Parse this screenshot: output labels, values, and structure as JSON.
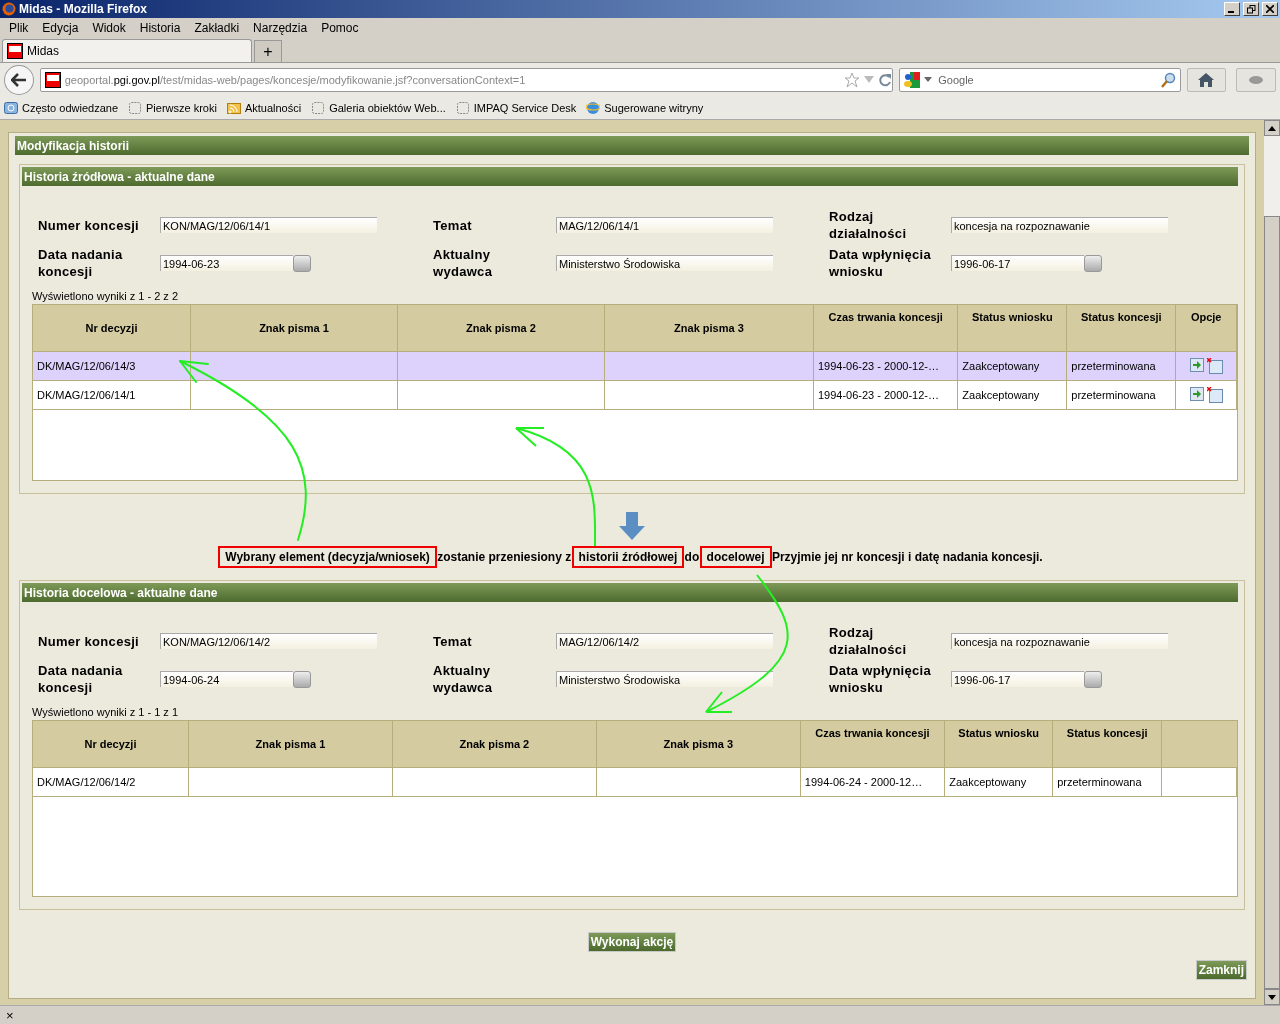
{
  "window": {
    "title": "Midas - Mozilla Firefox"
  },
  "menu": [
    "Plik",
    "Edycja",
    "Widok",
    "Historia",
    "Zakładki",
    "Narzędzia",
    "Pomoc"
  ],
  "tabs": [
    {
      "label": "Midas",
      "selected": true
    }
  ],
  "new_tab": "+",
  "address": {
    "host_pre": "geoportal.",
    "host": "pgi.gov.pl",
    "path": "/test/midas-web/pages/koncesje/modyfikowanie.jsf?conversationContext=1"
  },
  "search": {
    "placeholder": "Google"
  },
  "bookmarks": [
    {
      "label": "Często odwiedzane",
      "kind": "search"
    },
    {
      "label": "Pierwsze kroki",
      "kind": "page"
    },
    {
      "label": "Aktualności",
      "kind": "feed"
    },
    {
      "label": "Galeria obiektów Web...",
      "kind": "page"
    },
    {
      "label": "IMPAQ Service Desk",
      "kind": "page"
    },
    {
      "label": "Sugerowane witryny",
      "kind": "ie"
    }
  ],
  "panel": {
    "title": "Modyfikacja historii"
  },
  "sections": [
    {
      "title": "Historia źródłowa - aktualne dane",
      "fields": [
        {
          "label": "Numer koncesji",
          "value": "KON/MAG/12/06/14/1",
          "kind": "text"
        },
        {
          "label": "Temat",
          "value": "MAG/12/06/14/1",
          "kind": "text"
        },
        {
          "label": "Rodzaj działalności",
          "value": "koncesja na rozpoznawanie",
          "kind": "text"
        },
        {
          "label": "Data nadania koncesji",
          "value": "1994-06-23",
          "kind": "date"
        },
        {
          "label": "Aktualny wydawca",
          "value": "Ministerstwo Środowiska",
          "kind": "text"
        },
        {
          "label": "Data wpłynięcia wniosku",
          "value": "1996-06-17",
          "kind": "date"
        }
      ],
      "results": "Wyświetlono wyniki z 1 - 2 z 2",
      "columns": [
        "Nr decyzji",
        "Znak pisma 1",
        "Znak pisma 2",
        "Znak pisma 3",
        "Czas trwania koncesji",
        "Status wniosku",
        "Status koncesji",
        "Opcje"
      ],
      "rows": [
        {
          "cells": [
            "DK/MAG/12/06/14/3",
            "",
            "",
            "",
            "1994-06-23 - 2000-12-…",
            "Zaakceptowany",
            "przeterminowana"
          ],
          "options": true,
          "selected": true
        },
        {
          "cells": [
            "DK/MAG/12/06/14/1",
            "",
            "",
            "",
            "1994-06-23 - 2000-12-…",
            "Zaakceptowany",
            "przeterminowana"
          ],
          "options": true,
          "selected": false
        }
      ]
    },
    {
      "title": "Historia docelowa - aktualne dane",
      "fields": [
        {
          "label": "Numer koncesji",
          "value": "KON/MAG/12/06/14/2",
          "kind": "text"
        },
        {
          "label": "Temat",
          "value": "MAG/12/06/14/2",
          "kind": "text"
        },
        {
          "label": "Rodzaj działalności",
          "value": "koncesja na rozpoznawanie",
          "kind": "text"
        },
        {
          "label": "Data nadania koncesji",
          "value": "1994-06-24",
          "kind": "date"
        },
        {
          "label": "Aktualny wydawca",
          "value": "Ministerstwo Środowiska",
          "kind": "text"
        },
        {
          "label": "Data wpłynięcia wniosku",
          "value": "1996-06-17",
          "kind": "date"
        }
      ],
      "results": "Wyświetlono wyniki z 1 - 1 z 1",
      "columns": [
        "Nr decyzji",
        "Znak pisma 1",
        "Znak pisma 2",
        "Znak pisma 3",
        "Czas trwania koncesji",
        "Status wniosku",
        "Status koncesji"
      ],
      "rows": [
        {
          "cells": [
            "DK/MAG/12/06/14/2",
            "",
            "",
            "",
            "1994-06-24 - 2000-12…",
            "Zaakceptowany",
            "przeterminowana"
          ],
          "options": false,
          "selected": false
        }
      ]
    }
  ],
  "instruction": [
    {
      "text": "Wybrany element (decyzja/wniosek)",
      "highlighted": true
    },
    {
      "text": " zostanie przeniesiony z ",
      "highlighted": false
    },
    {
      "text": "historii źródłowej",
      "highlighted": true
    },
    {
      "text": " do ",
      "highlighted": false
    },
    {
      "text": "docelowej",
      "highlighted": true
    },
    {
      "text": " Przyjmie jej nr koncesji i datę nadania koncesji.",
      "highlighted": false
    }
  ],
  "buttons": {
    "execute": "Wykonaj akcję",
    "close": "Zamknij"
  },
  "status_bar": {
    "close": "×"
  }
}
